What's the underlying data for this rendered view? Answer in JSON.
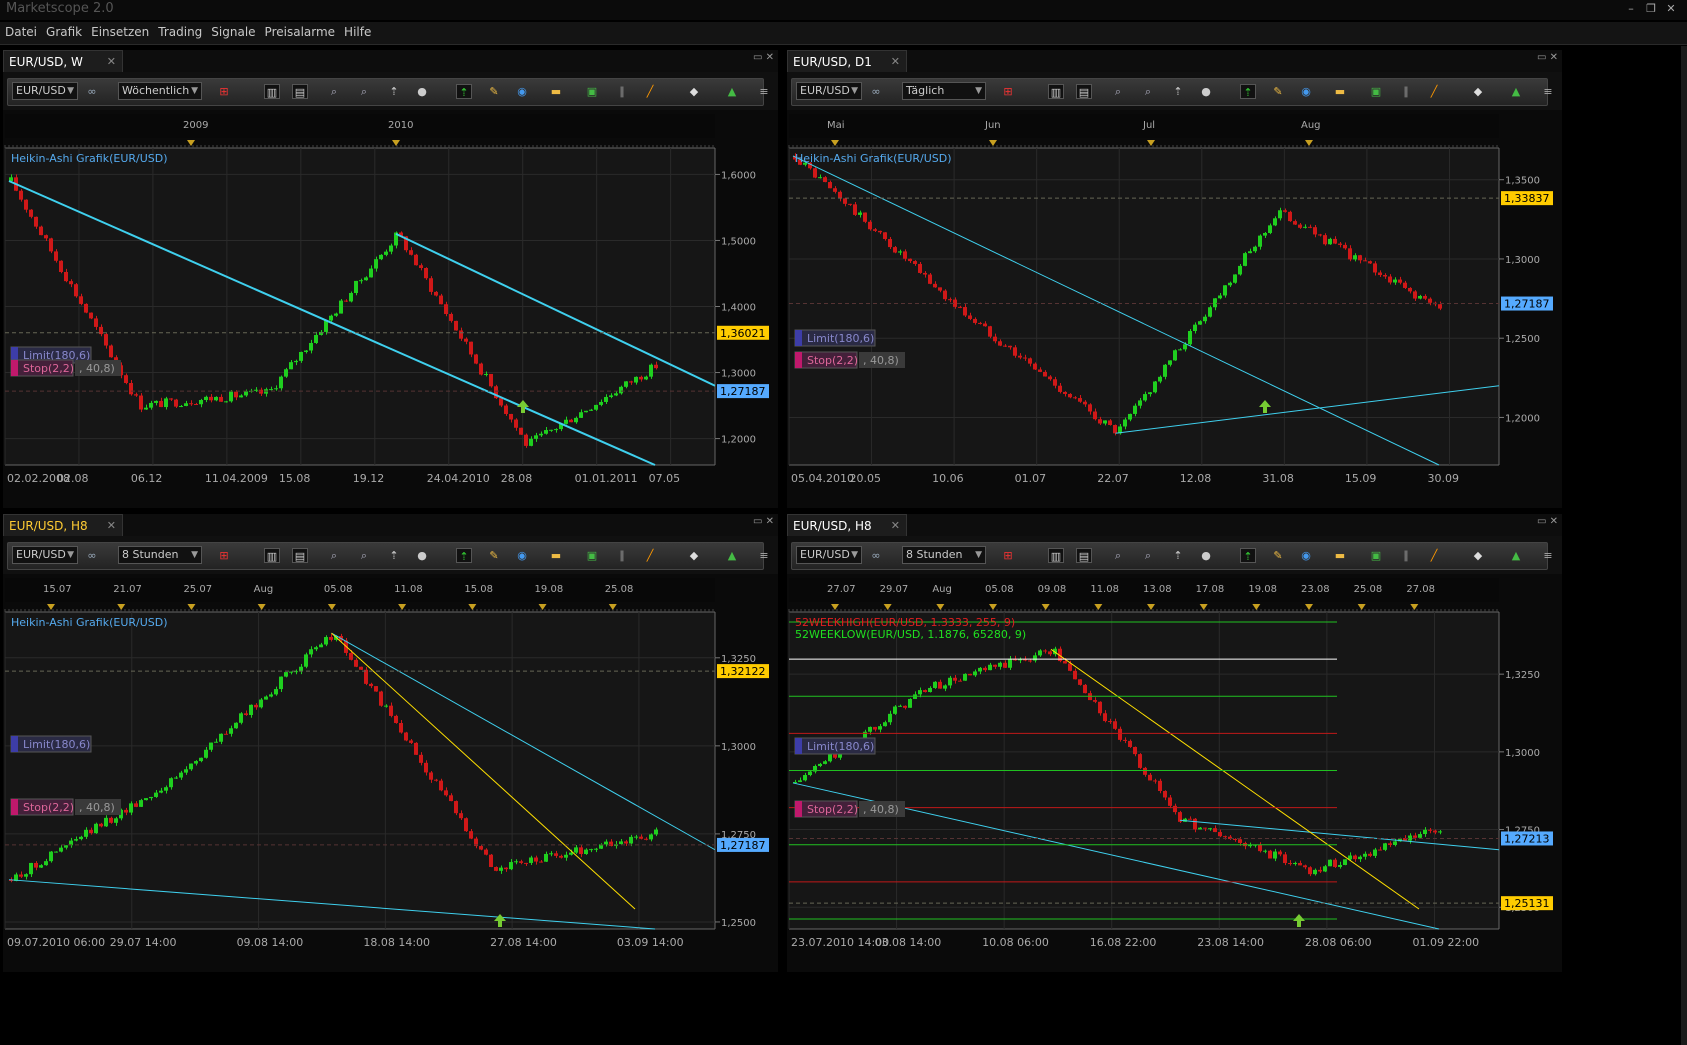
{
  "app": {
    "title": "Marketscope 2.0",
    "window_controls": [
      "–",
      "❐",
      "✕"
    ]
  },
  "menu": [
    "Datei",
    "Grafik",
    "Einsetzen",
    "Trading",
    "Signale",
    "Preisalarme",
    "Hilfe"
  ],
  "colors": {
    "bull": "#1fcf1f",
    "bear": "#d01818",
    "trend": "#3fd0ee",
    "yellow": "#ffe000",
    "price_yellow": "#ffcc00",
    "price_blue": "#55aaff",
    "limit": "#3d3da8",
    "stop": "#c0196c"
  },
  "panels": [
    {
      "tab": "EUR/USD, W",
      "tab_active_color": "#ffffff",
      "symbol": "EUR/USD",
      "period": "Wöchentlich",
      "chart_title": "Heikin-Ashi Grafik(EUR/USD)",
      "top_labels": [
        "2009",
        "2010"
      ],
      "x_labels": [
        "02.02.2008",
        "02.08",
        "06.12",
        "11.04.2009",
        "15.08",
        "19.12",
        "24.04.2010",
        "28.08",
        "01.01.2011",
        "07.05"
      ],
      "y_labels": [
        "1,6000",
        "1,5000",
        "1,4000",
        "1,3000",
        "1,2000"
      ],
      "price_tags": [
        {
          "value": "1,36021",
          "color": "yellow"
        },
        {
          "value": "1,27187",
          "color": "blue"
        }
      ],
      "order_labels": {
        "limit": "Limit(180,6)",
        "stop": "Stop(2,2)",
        "stop_extra": ", 40,8)"
      },
      "indicator_lines": []
    },
    {
      "tab": "EUR/USD, D1",
      "tab_active_color": "#ffffff",
      "symbol": "EUR/USD",
      "period": "Täglich",
      "chart_title": "Heikin-Ashi Grafik(EUR/USD)",
      "top_labels": [
        "Mai",
        "Jun",
        "Jul",
        "Aug"
      ],
      "x_labels": [
        "05.04.2010",
        "20.05",
        "10.06",
        "01.07",
        "22.07",
        "12.08",
        "31.08",
        "15.09",
        "30.09"
      ],
      "y_labels": [
        "1,3500",
        "1,3000",
        "1,2500",
        "1,2000"
      ],
      "price_tags": [
        {
          "value": "1,33837",
          "color": "yellow"
        },
        {
          "value": "1,27187",
          "color": "blue"
        }
      ],
      "order_labels": {
        "limit": "Limit(180,6)",
        "stop": "Stop(2,2)",
        "stop_extra": ", 40,8)"
      },
      "indicator_lines": []
    },
    {
      "tab": "EUR/USD, H8",
      "tab_active_color": "#ffcc33",
      "symbol": "EUR/USD",
      "period": "8 Stunden",
      "chart_title": "Heikin-Ashi Grafik(EUR/USD)",
      "top_labels": [
        "15.07",
        "21.07",
        "25.07",
        "Aug",
        "05.08",
        "11.08",
        "15.08",
        "19.08",
        "25.08"
      ],
      "x_labels": [
        "09.07.2010 06:00",
        "29.07 14:00",
        "09.08 14:00",
        "18.08 14:00",
        "27.08 14:00",
        "03.09 14:00"
      ],
      "y_labels": [
        "1,3250",
        "1,3000",
        "1,2750",
        "1,2500"
      ],
      "price_tags": [
        {
          "value": "1,32122",
          "color": "yellow"
        },
        {
          "value": "1,27187",
          "color": "blue"
        }
      ],
      "order_labels": {
        "limit": "Limit(180,6)",
        "stop": "Stop(2,2)",
        "stop_extra": ", 40,8)"
      },
      "indicator_lines": []
    },
    {
      "tab": "EUR/USD, H8",
      "tab_active_color": "#ffffff",
      "symbol": "EUR/USD",
      "period": "8 Stunden",
      "chart_title": "",
      "top_labels": [
        "27.07",
        "29.07",
        "Aug",
        "05.08",
        "09.08",
        "11.08",
        "13.08",
        "17.08",
        "19.08",
        "23.08",
        "25.08",
        "27.08"
      ],
      "x_labels": [
        "23.07.2010 14:00",
        "03.08 14:00",
        "10.08 06:00",
        "16.08 22:00",
        "23.08 14:00",
        "28.08 06:00",
        "01.09 22:00"
      ],
      "y_labels": [
        "1,3250",
        "1,3000",
        "1,2750",
        "1,2500"
      ],
      "price_tags": [
        {
          "value": "1,27213",
          "color": "blue"
        },
        {
          "value": "1,25131",
          "color": "yellow"
        }
      ],
      "order_labels": {
        "limit": "Limit(180,6)",
        "stop": "Stop(2,2)",
        "stop_extra": ", 40,8)"
      },
      "indicator_lines": [
        {
          "text": "52WEEKHIGH(EUR/USD, 1.3333, 255, 9)",
          "color": "#e02020"
        },
        {
          "text": "52WEEKLOW(EUR/USD, 1.1876, 65280, 9)",
          "color": "#20e020"
        }
      ]
    }
  ],
  "chart_data": [
    {
      "type": "candlestick",
      "title": "Heikin-Ashi Grafik(EUR/USD)",
      "timeframe": "W",
      "ylim": [
        1.16,
        1.64
      ],
      "x_ticks": [
        "02.02.2008",
        "02.08",
        "06.12",
        "11.04.2009",
        "15.08",
        "19.12",
        "24.04.2010",
        "28.08",
        "01.01.2011",
        "07.05"
      ],
      "key_points": [
        {
          "x": "2008-07",
          "y": 1.59
        },
        {
          "x": "2008-11",
          "y": 1.25
        },
        {
          "x": "2009-03",
          "y": 1.27
        },
        {
          "x": "2009-11",
          "y": 1.51
        },
        {
          "x": "2010-06",
          "y": 1.19
        },
        {
          "x": "2010-08",
          "y": 1.31
        }
      ],
      "last_price": 1.27187
    },
    {
      "type": "candlestick",
      "title": "Heikin-Ashi Grafik(EUR/USD)",
      "timeframe": "D1",
      "ylim": [
        1.17,
        1.37
      ],
      "x_ticks": [
        "05.04.2010",
        "20.05",
        "10.06",
        "01.07",
        "22.07",
        "12.08",
        "31.08",
        "15.09",
        "30.09"
      ],
      "key_points": [
        {
          "x": "2010-04-13",
          "y": 1.365
        },
        {
          "x": "2010-05-15",
          "y": 1.27
        },
        {
          "x": "2010-06-07",
          "y": 1.19
        },
        {
          "x": "2010-08-06",
          "y": 1.33
        },
        {
          "x": "2010-08-24",
          "y": 1.268
        }
      ],
      "last_price": 1.27187
    },
    {
      "type": "candlestick",
      "title": "Heikin-Ashi Grafik(EUR/USD)",
      "timeframe": "H8",
      "ylim": [
        1.248,
        1.338
      ],
      "x_ticks": [
        "09.07.2010 06:00",
        "29.07 14:00",
        "09.08 14:00",
        "18.08 14:00",
        "27.08 14:00",
        "03.09 14:00"
      ],
      "key_points": [
        {
          "x": "2010-07-09",
          "y": 1.262
        },
        {
          "x": "2010-07-21",
          "y": 1.29
        },
        {
          "x": "2010-08-06",
          "y": 1.332
        },
        {
          "x": "2010-08-24",
          "y": 1.265
        },
        {
          "x": "2010-08-26",
          "y": 1.275
        }
      ],
      "last_price": 1.27187
    },
    {
      "type": "candlestick",
      "title": "",
      "timeframe": "H8",
      "ylim": [
        1.243,
        1.345
      ],
      "x_ticks": [
        "23.07.2010 14:00",
        "03.08 14:00",
        "10.08 06:00",
        "16.08 22:00",
        "23.08 14:00",
        "28.08 06:00",
        "01.09 22:00"
      ],
      "key_points": [
        {
          "x": "2010-07-23",
          "y": 1.29
        },
        {
          "x": "2010-08-03",
          "y": 1.32
        },
        {
          "x": "2010-08-09",
          "y": 1.333
        },
        {
          "x": "2010-08-13",
          "y": 1.278
        },
        {
          "x": "2010-08-24",
          "y": 1.262
        },
        {
          "x": "2010-08-27",
          "y": 1.275
        }
      ],
      "last_price": 1.27213,
      "lower_price": 1.25131
    }
  ]
}
